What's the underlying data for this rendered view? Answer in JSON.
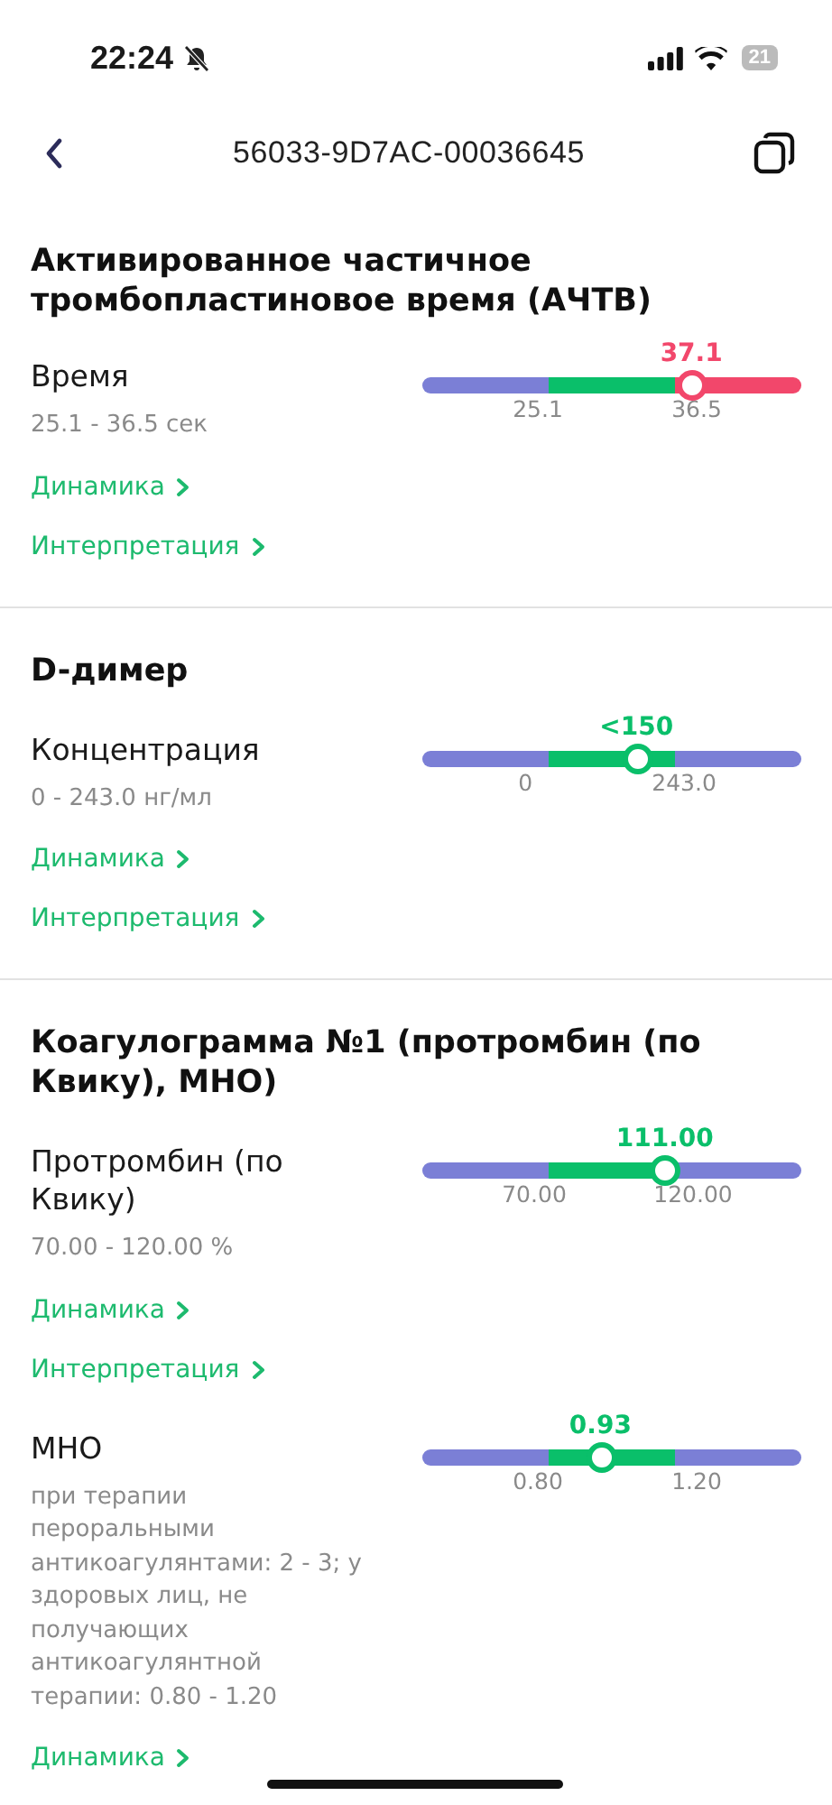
{
  "status_bar": {
    "time": "22:24",
    "battery": "21"
  },
  "nav": {
    "title": "56033-9D7AC-00036645"
  },
  "sections": [
    {
      "title": "Активированное частичное тромбопластиновое время (АЧТВ)",
      "tests": [
        {
          "name": "Время",
          "range": "25.1 - 36.5 сек",
          "reading": "37.1",
          "out_of_range": true,
          "level": 0.71,
          "low_tick": "25.1",
          "high_tick": "36.5",
          "links": [
            "Динамика",
            "Интерпретация"
          ]
        }
      ]
    },
    {
      "title": "D-димер",
      "tests": [
        {
          "name": "Концентрация",
          "range": "0 - 243.0 нг/мл",
          "reading": "<150",
          "out_of_range": false,
          "level": 0.565,
          "low_tick": "0",
          "high_tick": "243.0",
          "links": [
            "Динамика",
            "Интерпретация"
          ]
        }
      ]
    },
    {
      "title": "Коагулограмма №1 (протромбин (по Квику), МНО)",
      "tests": [
        {
          "name": "Протромбин (по Квику)",
          "range": "70.00 - 120.00 %",
          "reading": "111.00",
          "out_of_range": false,
          "level": 0.64,
          "low_tick": "70.00",
          "high_tick": "120.00",
          "links": [
            "Динамика",
            "Интерпретация"
          ]
        },
        {
          "name": "МНО",
          "range": "при терапии пероральными антикоагулянтами: 2 - 3; у здоровых лиц, не получающих антикоагулянтной терапии: 0.80 - 1.20",
          "reading": "0.93",
          "out_of_range": false,
          "level": 0.47,
          "low_tick": "0.80",
          "high_tick": "1.20",
          "links": [
            "Динамика"
          ]
        }
      ]
    }
  ]
}
